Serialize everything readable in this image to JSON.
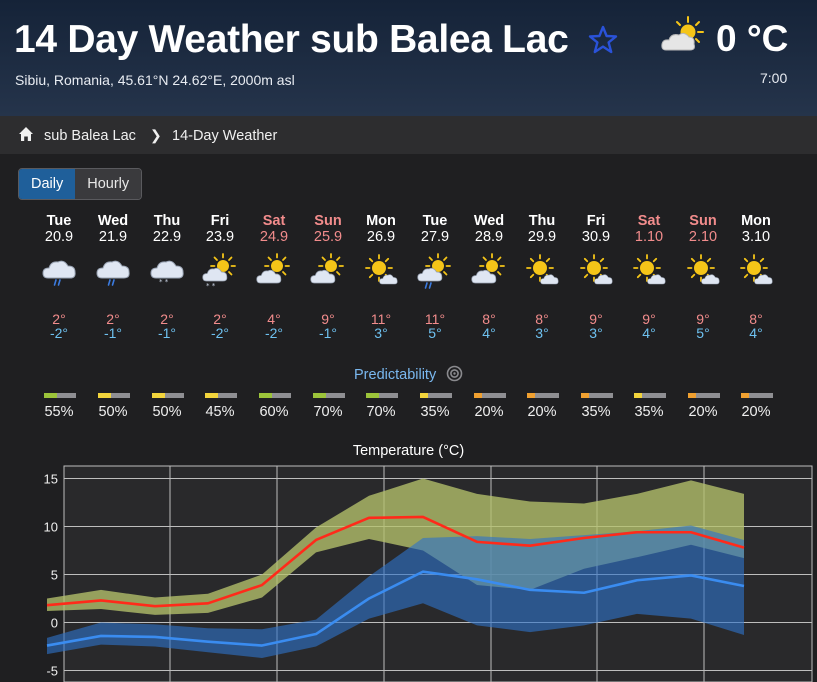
{
  "header": {
    "title": "14 Day Weather sub Balea Lac",
    "subtitle": "Sibiu, Romania, 45.61°N 24.62°E, 2000m asl",
    "current_temp": "0 °C",
    "current_time": "7:00",
    "current_icon": "partly-cloudy-sun-icon",
    "favorite_icon": "star-outline-icon"
  },
  "breadcrumb": {
    "home_icon": "home-icon",
    "item1": "sub Balea Lac",
    "separator": "❯",
    "item2": "14-Day Weather"
  },
  "tabs": [
    {
      "label": "Daily",
      "active": true
    },
    {
      "label": "Hourly",
      "active": false
    }
  ],
  "days": [
    {
      "name": "Tue",
      "date": "20.9",
      "weekend": false,
      "icon": "rain-cloud-icon",
      "max": "2°",
      "min": "-2°",
      "pred": "55%",
      "pred_color": "#9cc43a"
    },
    {
      "name": "Wed",
      "date": "21.9",
      "weekend": false,
      "icon": "rain-cloud-icon",
      "max": "2°",
      "min": "-1°",
      "pred": "50%",
      "pred_color": "#f2d43c"
    },
    {
      "name": "Thu",
      "date": "22.9",
      "weekend": false,
      "icon": "snow-cloud-icon",
      "max": "2°",
      "min": "-1°",
      "pred": "50%",
      "pred_color": "#f2d43c"
    },
    {
      "name": "Fri",
      "date": "23.9",
      "weekend": false,
      "icon": "sun-cloud-snow-icon",
      "max": "2°",
      "min": "-2°",
      "pred": "45%",
      "pred_color": "#f2d43c"
    },
    {
      "name": "Sat",
      "date": "24.9",
      "weekend": true,
      "icon": "sun-cloud-icon",
      "max": "4°",
      "min": "-2°",
      "pred": "60%",
      "pred_color": "#9cc43a"
    },
    {
      "name": "Sun",
      "date": "25.9",
      "weekend": true,
      "icon": "sun-cloud-icon",
      "max": "9°",
      "min": "-1°",
      "pred": "70%",
      "pred_color": "#9cc43a"
    },
    {
      "name": "Mon",
      "date": "26.9",
      "weekend": false,
      "icon": "sun-small-cloud-icon",
      "max": "11°",
      "min": "3°",
      "pred": "70%",
      "pred_color": "#9cc43a"
    },
    {
      "name": "Tue",
      "date": "27.9",
      "weekend": false,
      "icon": "sun-cloud-rain-icon",
      "max": "11°",
      "min": "5°",
      "pred": "35%",
      "pred_color": "#f2d43c"
    },
    {
      "name": "Wed",
      "date": "28.9",
      "weekend": false,
      "icon": "sun-cloud-icon",
      "max": "8°",
      "min": "4°",
      "pred": "20%",
      "pred_color": "#f0a030"
    },
    {
      "name": "Thu",
      "date": "29.9",
      "weekend": false,
      "icon": "sun-small-cloud-icon",
      "max": "8°",
      "min": "3°",
      "pred": "20%",
      "pred_color": "#f0a030"
    },
    {
      "name": "Fri",
      "date": "30.9",
      "weekend": false,
      "icon": "sun-small-cloud-icon",
      "max": "9°",
      "min": "3°",
      "pred": "35%",
      "pred_color": "#f0a030"
    },
    {
      "name": "Sat",
      "date": "1.10",
      "weekend": true,
      "icon": "sun-small-cloud-icon",
      "max": "9°",
      "min": "4°",
      "pred": "35%",
      "pred_color": "#f2d43c"
    },
    {
      "name": "Sun",
      "date": "2.10",
      "weekend": true,
      "icon": "sun-small-cloud-icon",
      "max": "9°",
      "min": "5°",
      "pred": "20%",
      "pred_color": "#f0a030"
    },
    {
      "name": "Mon",
      "date": "3.10",
      "weekend": false,
      "icon": "sun-small-cloud-icon",
      "max": "8°",
      "min": "4°",
      "pred": "20%",
      "pred_color": "#f0a030"
    }
  ],
  "predictability": {
    "label": "Predictability",
    "icon": "target-info-icon"
  },
  "chart_data": {
    "type": "line",
    "title": "Temperature (°C)",
    "xlabel": "",
    "ylabel": "",
    "ylim": [
      -5,
      16
    ],
    "yticks": [
      15,
      10,
      5,
      0,
      -5
    ],
    "grid": true,
    "categories": [
      "Tue 20.9",
      "Wed 21.9",
      "Thu 22.9",
      "Fri 23.9",
      "Sat 24.9",
      "Sun 25.9",
      "Mon 26.9",
      "Tue 27.9",
      "Wed 28.9",
      "Thu 29.9",
      "Fri 30.9",
      "Sat 1.10",
      "Sun 2.10",
      "Mon 3.10"
    ],
    "series": [
      {
        "values": [
          1.8,
          2.3,
          1.7,
          2.0,
          3.9,
          8.6,
          10.9,
          11.0,
          8.4,
          8.0,
          8.8,
          9.4,
          9.4,
          7.8
        ],
        "color": "#ff2a1a"
      },
      {
        "values": [
          -2.4,
          -1.4,
          -1.5,
          -2.0,
          -2.4,
          -1.2,
          2.5,
          5.3,
          4.5,
          3.4,
          3.1,
          4.4,
          4.9,
          3.8
        ],
        "color": "#3a8cf0"
      }
    ],
    "bands": [
      {
        "upper": [
          2.5,
          3.4,
          2.6,
          3.0,
          5.0,
          9.9,
          13.2,
          15.0,
          13.4,
          12.6,
          12.4,
          13.4,
          14.8,
          13.4
        ],
        "lower": [
          1.2,
          1.4,
          0.8,
          1.0,
          2.6,
          7.3,
          8.7,
          7.5,
          3.9,
          3.4,
          5.6,
          6.8,
          8.1,
          6.7
        ],
        "color": "#b5c26b"
      },
      {
        "upper": [
          -1.6,
          0.0,
          -0.2,
          -0.6,
          -0.7,
          0.3,
          4.8,
          8.8,
          9.0,
          8.7,
          9.1,
          9.5,
          10.1,
          8.6
        ],
        "lower": [
          -3.3,
          -2.3,
          -2.5,
          -3.1,
          -3.7,
          -2.5,
          0.4,
          2.0,
          -0.3,
          -1.0,
          -0.3,
          0.9,
          0.4,
          -1.3
        ],
        "color": "#2f73c8"
      }
    ]
  }
}
